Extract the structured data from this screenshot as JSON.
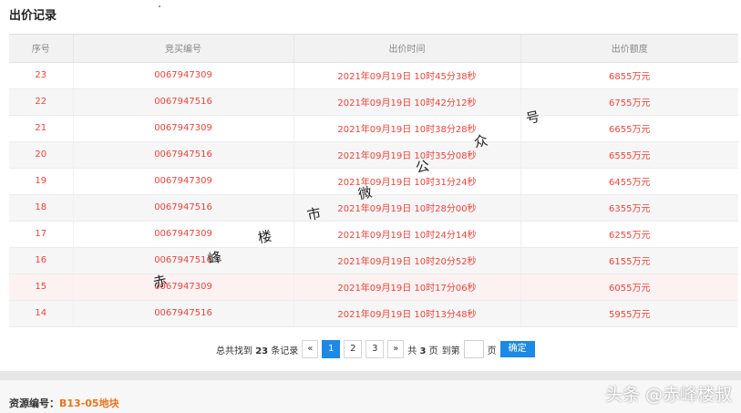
{
  "section_title": "出价记录",
  "table": {
    "headers": [
      "序号",
      "竞买编号",
      "出价时间",
      "出价额度"
    ],
    "rows": [
      [
        "23",
        "0067947309",
        "2021年09月19日 10时45分38秒",
        "6855万元"
      ],
      [
        "22",
        "0067947516",
        "2021年09月19日 10时42分12秒",
        "6755万元"
      ],
      [
        "21",
        "0067947309",
        "2021年09月19日 10时38分28秒",
        "6655万元"
      ],
      [
        "20",
        "0067947516",
        "2021年09月19日 10时35分08秒",
        "6555万元"
      ],
      [
        "19",
        "0067947309",
        "2021年09月19日 10时31分24秒",
        "6455万元"
      ],
      [
        "18",
        "0067947516",
        "2021年09月19日 10时28分00秒",
        "6355万元"
      ],
      [
        "17",
        "0067947309",
        "2021年09月19日 10时24分14秒",
        "6255万元"
      ],
      [
        "16",
        "0067947516",
        "2021年09月19日 10时20分52秒",
        "6155万元"
      ],
      [
        "15",
        "0067947309",
        "2021年09月19日 10时17分06秒",
        "6055万元"
      ],
      [
        "14",
        "0067947516",
        "2021年09月19日 10时13分48秒",
        "5955万元"
      ]
    ]
  },
  "pagination": {
    "summary_prefix": "总共找到",
    "total": "23",
    "summary_suffix": "条记录",
    "prev": "«",
    "pages": [
      "1",
      "2",
      "3"
    ],
    "current_page": "1",
    "next": "»",
    "total_pages_prefix": "共",
    "total_pages": "3",
    "total_pages_suffix": "页",
    "goto_prefix": "到第",
    "goto_suffix": "页",
    "goto_value": "",
    "confirm": "确定"
  },
  "resource": {
    "label": "资源编号：",
    "value": "B13-05地块"
  },
  "watermark": {
    "chars": [
      "赤",
      "峰",
      "楼",
      "市",
      "微",
      "公",
      "众",
      "号"
    ],
    "corner_text": "头条 @赤峰楼叔"
  },
  "colors": {
    "accent_blue": "#1e88e5",
    "row_text_red": "#e8453c",
    "resource_orange": "#e8731e"
  }
}
